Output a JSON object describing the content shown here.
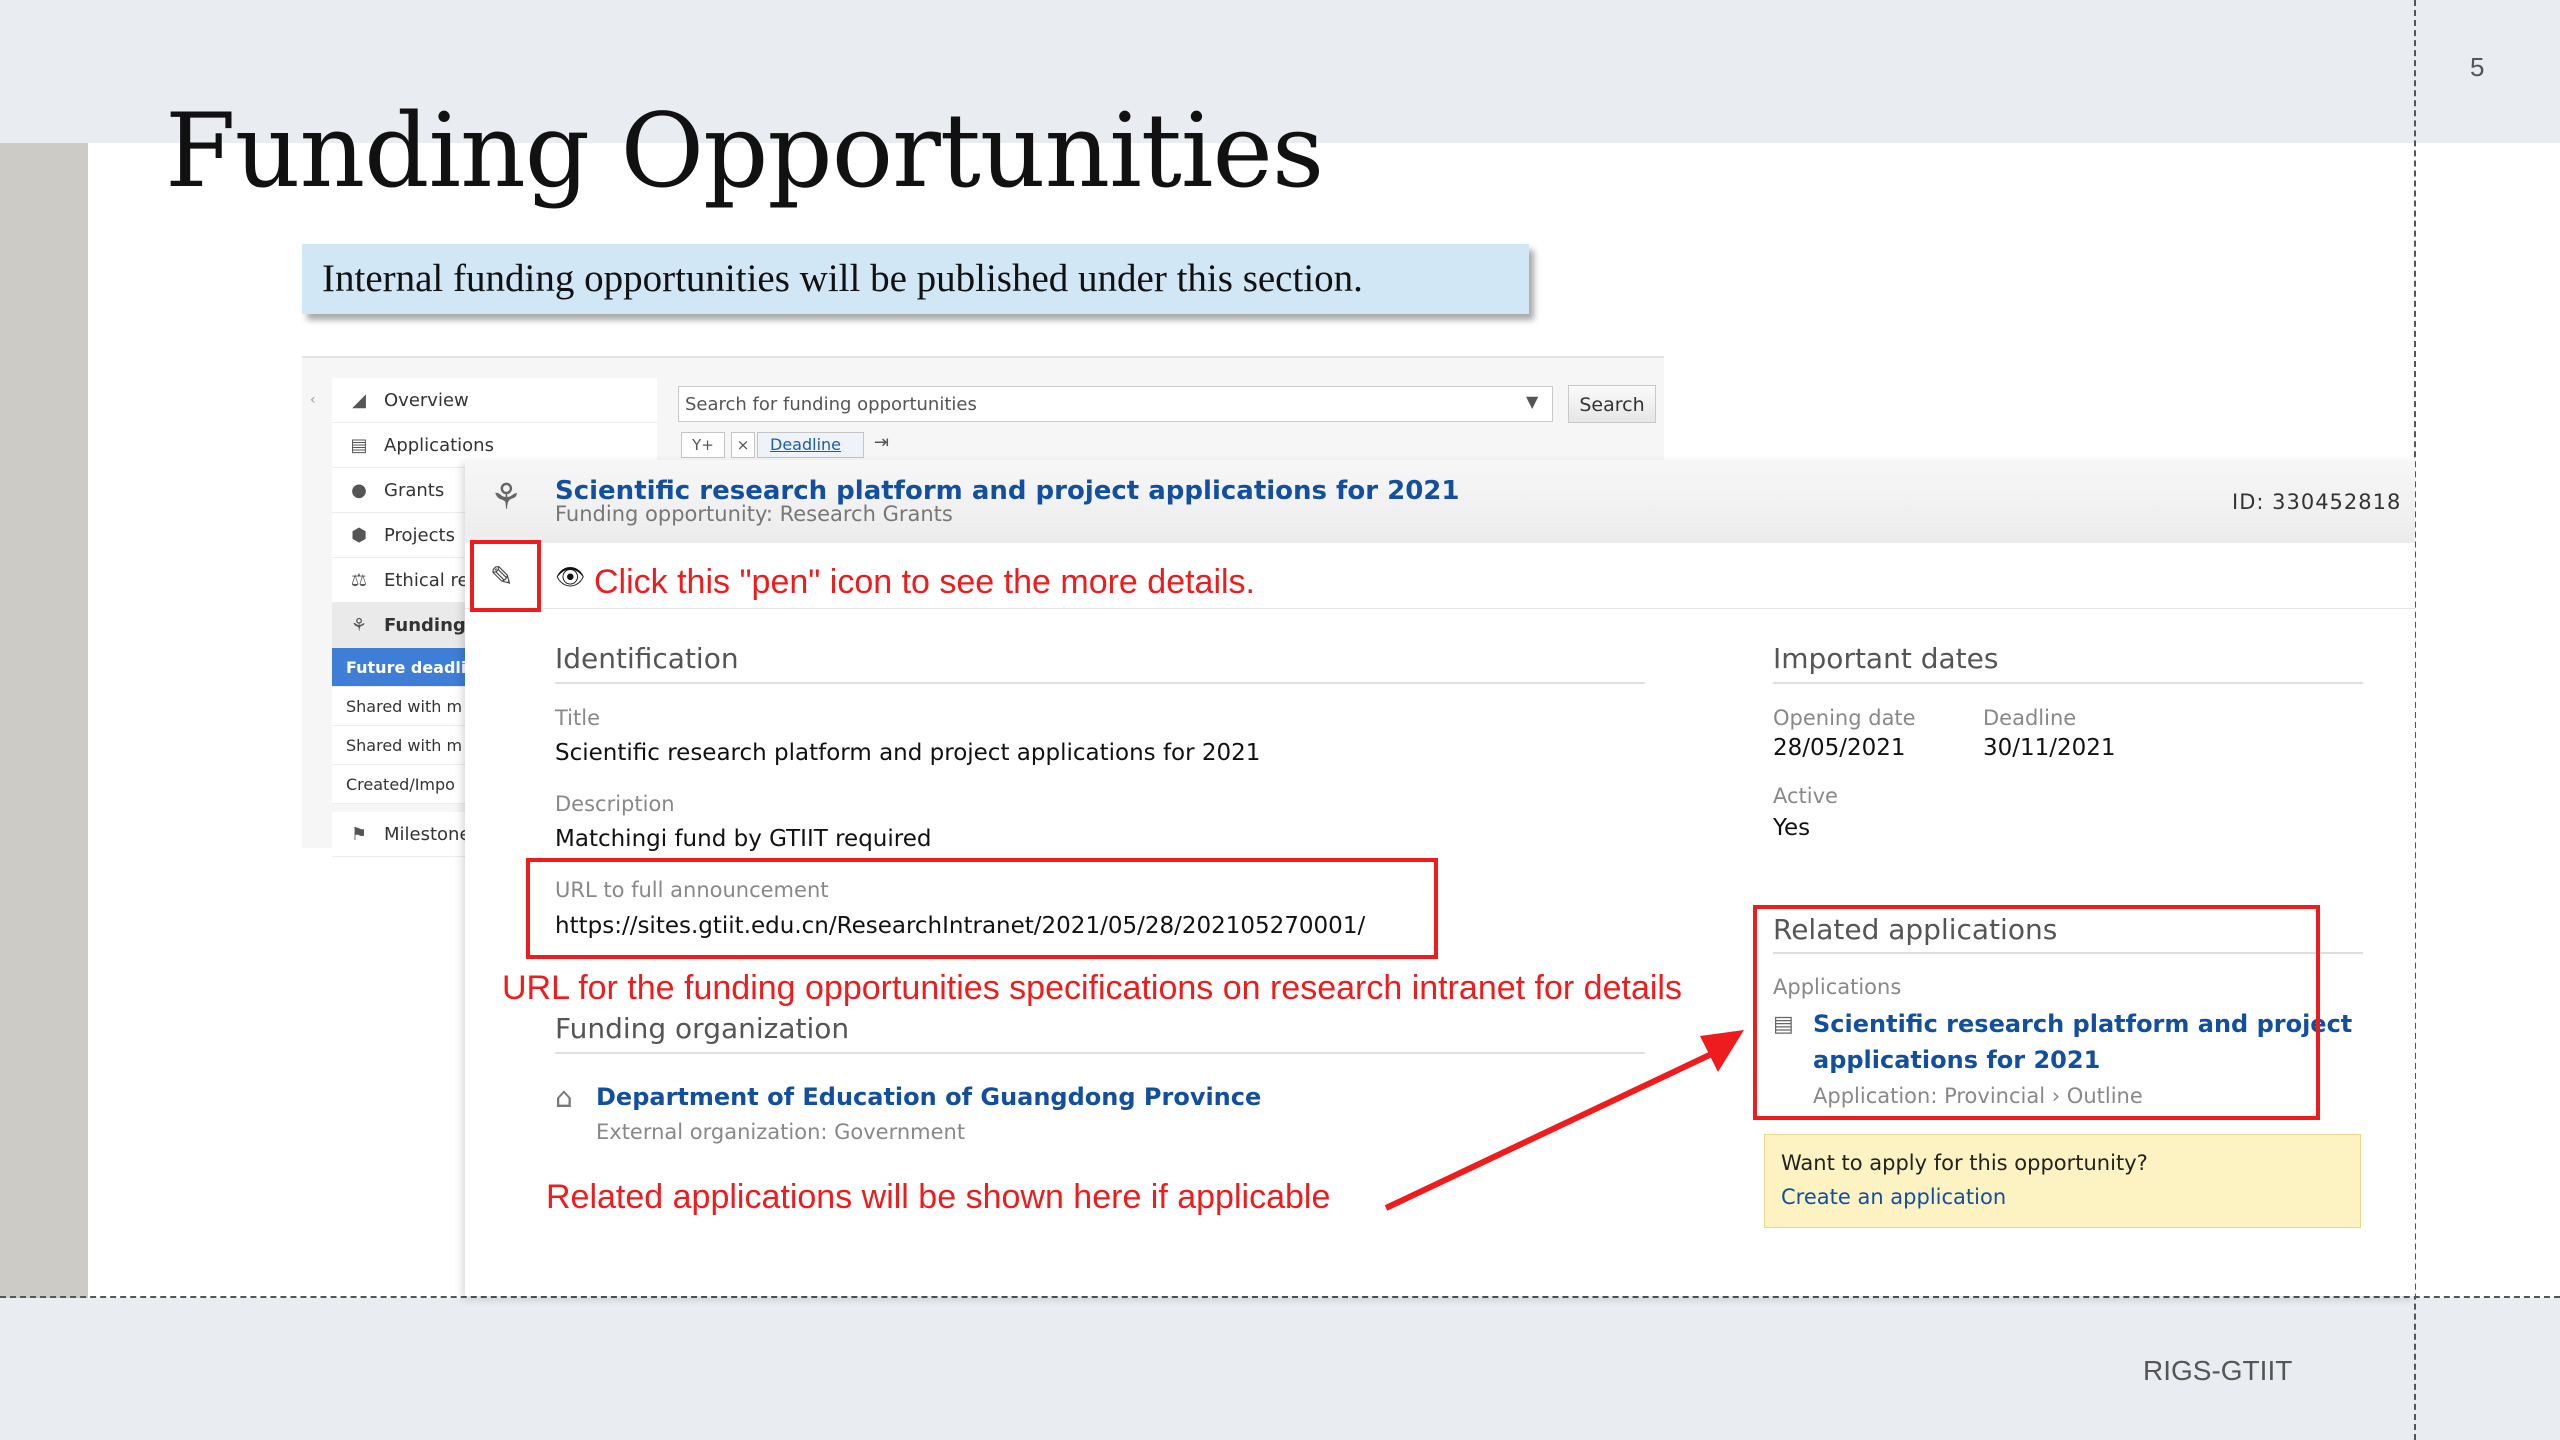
{
  "slide": {
    "title": "Funding Opportunities",
    "banner": "Internal funding opportunities will be published under this section.",
    "page_number": "5",
    "footer": "RIGS-GTIIT"
  },
  "nav": {
    "items": [
      {
        "label": "Overview",
        "icon": "overview-icon"
      },
      {
        "label": "Applications",
        "icon": "applications-icon"
      },
      {
        "label": "Grants",
        "icon": "grants-icon"
      },
      {
        "label": "Projects",
        "icon": "projects-icon"
      },
      {
        "label": "Ethical re",
        "icon": "ethical-review-icon"
      },
      {
        "label": "Funding",
        "icon": "funding-icon"
      }
    ],
    "sub_items": [
      "Future deadli",
      "Shared with m",
      "Shared with m",
      "Created/Impo"
    ],
    "milestones": "Milestone"
  },
  "search": {
    "placeholder": "Search for funding opportunities",
    "button": "Search",
    "filter_add": "Y+",
    "filter_remove": "×",
    "filter_deadline": "Deadline"
  },
  "detail": {
    "title": "Scientific research platform and project applications for 2021",
    "subtitle": "Funding opportunity: Research Grants",
    "id": "ID: 330452818",
    "identification": {
      "heading": "Identification",
      "title_label": "Title",
      "title_value": "Scientific research platform and project applications for 2021",
      "description_label": "Description",
      "description_value": "Matchingi fund by GTIIT required",
      "url_label": "URL to full announcement",
      "url_value": "https://sites.gtiit.edu.cn/ResearchIntranet/2021/05/28/202105270001/"
    },
    "important_dates": {
      "heading": "Important dates",
      "opening_label": "Opening date",
      "opening_value": "28/05/2021",
      "deadline_label": "Deadline",
      "deadline_value": "30/11/2021",
      "active_label": "Active",
      "active_value": "Yes"
    },
    "funding_org": {
      "heading": "Funding organization",
      "name": "Department of Education of Guangdong Province",
      "type": "External organization: Government"
    },
    "related": {
      "heading": "Related applications",
      "label": "Applications",
      "app_title_line1": "Scientific research platform and project",
      "app_title_line2": "applications for 2021",
      "app_meta": "Application: Provincial › Outline"
    },
    "cta": {
      "question": "Want to apply for this opportunity?",
      "link": "Create an application"
    }
  },
  "annotations": {
    "pen": "Click this \"pen\" icon to see the more details.",
    "url": "URL for the funding opportunities specifications on research intranet for details",
    "related": "Related applications will be shown here if applicable",
    "color": "#ee1c1c"
  },
  "colors": {
    "link": "#124f9f",
    "banner": "#d2e7f5",
    "nav_active": "#3e7ed6",
    "cta_bg": "#fdf2c2"
  }
}
